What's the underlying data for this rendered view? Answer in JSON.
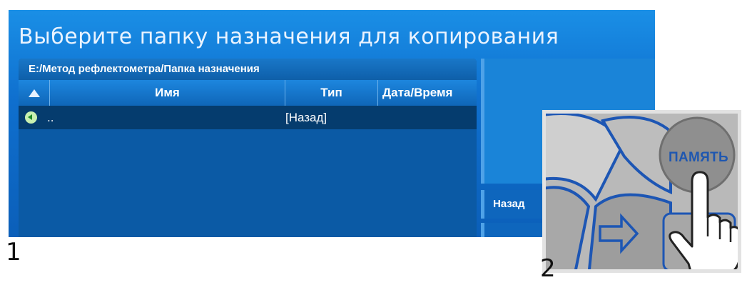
{
  "dialog": {
    "title": "Выберите папку назначения для копирования",
    "path": "E:/Метод рефлектометра/Папка назначения"
  },
  "table": {
    "columns": [
      "Имя",
      "Тип",
      "Дата/Время"
    ],
    "rows": [
      {
        "icon": "back-arrow-icon",
        "name": "..",
        "type": "[Назад]"
      }
    ]
  },
  "side": {
    "button_label": "Назад"
  },
  "inset": {
    "button_label": "ПАМЯТЬ"
  },
  "labels": {
    "step1": "1",
    "step2": "2"
  },
  "colors": {
    "screen_blue": "#0f6fce",
    "selected_row": "#053c6e",
    "inset_text": "#1f57b0"
  }
}
